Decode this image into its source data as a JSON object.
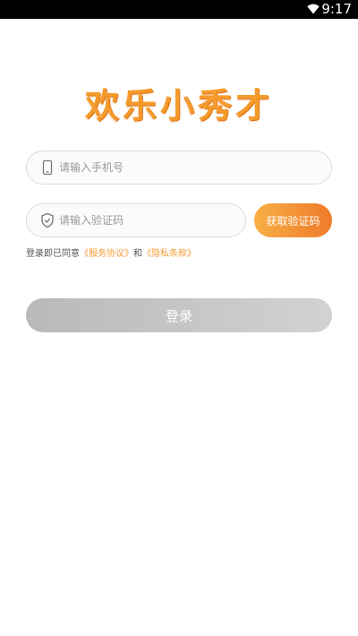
{
  "status_bar": {
    "time": "9:17",
    "icons": [
      "wifi-icon"
    ]
  },
  "logo": {
    "text": "欢乐小秀才",
    "color": "#f59a2c"
  },
  "phone_field": {
    "placeholder": "请输入手机号",
    "value": "",
    "icon": "phone-icon"
  },
  "code_field": {
    "placeholder": "请输入验证码",
    "value": "",
    "icon": "shield-icon"
  },
  "get_code_button": {
    "label": "获取验证码",
    "color_start": "#f8b046",
    "color_end": "#f07a2a"
  },
  "agreement": {
    "prefix": "登录即已同意",
    "service_link": "《服务协议》",
    "conjunction": "和",
    "privacy_link": "《隐私条款》",
    "link_color": "#f39c34"
  },
  "login_button": {
    "label": "登录",
    "color": "#c4c4c4"
  }
}
